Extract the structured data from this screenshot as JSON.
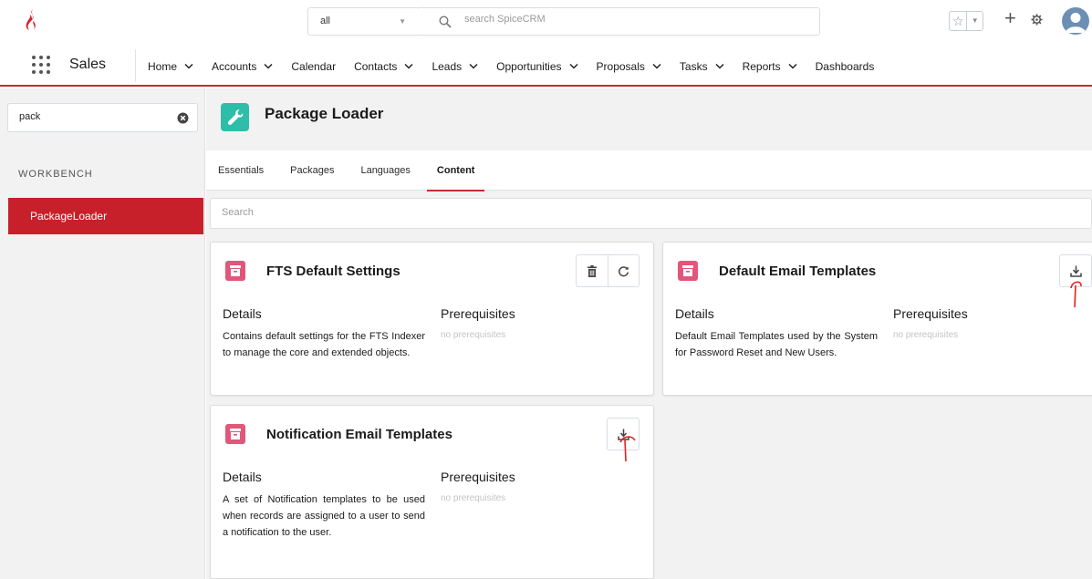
{
  "header": {
    "scope_select": "all",
    "search_placeholder": "search SpiceCRM"
  },
  "nav": {
    "app_name": "Sales",
    "items": [
      {
        "label": "Home",
        "dropdown": true
      },
      {
        "label": "Accounts",
        "dropdown": true
      },
      {
        "label": "Calendar",
        "dropdown": false
      },
      {
        "label": "Contacts",
        "dropdown": true
      },
      {
        "label": "Leads",
        "dropdown": true
      },
      {
        "label": "Opportunities",
        "dropdown": true
      },
      {
        "label": "Proposals",
        "dropdown": true
      },
      {
        "label": "Tasks",
        "dropdown": true
      },
      {
        "label": "Reports",
        "dropdown": true
      },
      {
        "label": "Dashboards",
        "dropdown": false
      }
    ]
  },
  "sidebar": {
    "search_value": "pack",
    "heading": "WORKBENCH",
    "items": [
      {
        "label": "PackageLoader",
        "active": true
      }
    ]
  },
  "page": {
    "title": "Package Loader",
    "tabs": [
      {
        "label": "Essentials",
        "active": false
      },
      {
        "label": "Packages",
        "active": false
      },
      {
        "label": "Languages",
        "active": false
      },
      {
        "label": "Content",
        "active": true
      }
    ],
    "search_placeholder": "Search"
  },
  "cards": [
    {
      "title": "FTS Default Settings",
      "details_label": "Details",
      "prereq_label": "Prerequisites",
      "description": "Contains default settings for the FTS Indexer to manage the core and extended objects.",
      "prerequisites": "no prerequisites",
      "actions": [
        "delete-icon",
        "refresh-icon"
      ]
    },
    {
      "title": "Default Email Templates",
      "details_label": "Details",
      "prereq_label": "Prerequisites",
      "description": "Default Email Templates used by the System for Password Reset and New Users.",
      "prerequisites": "no prerequisites",
      "actions": [
        "download-icon"
      ]
    },
    {
      "title": "Notification Email Templates",
      "details_label": "Details",
      "prereq_label": "Prerequisites",
      "description": "A set of Notification templates to be used when records are assigned to a user to send a notification to the user.",
      "prerequisites": "no prerequisites",
      "actions": [
        "download-icon"
      ]
    }
  ],
  "colors": {
    "accent": "#c32d32",
    "sidebar_active": "#c8202a",
    "page_icon": "#2ebda9",
    "card_icon": "#e2567a"
  }
}
